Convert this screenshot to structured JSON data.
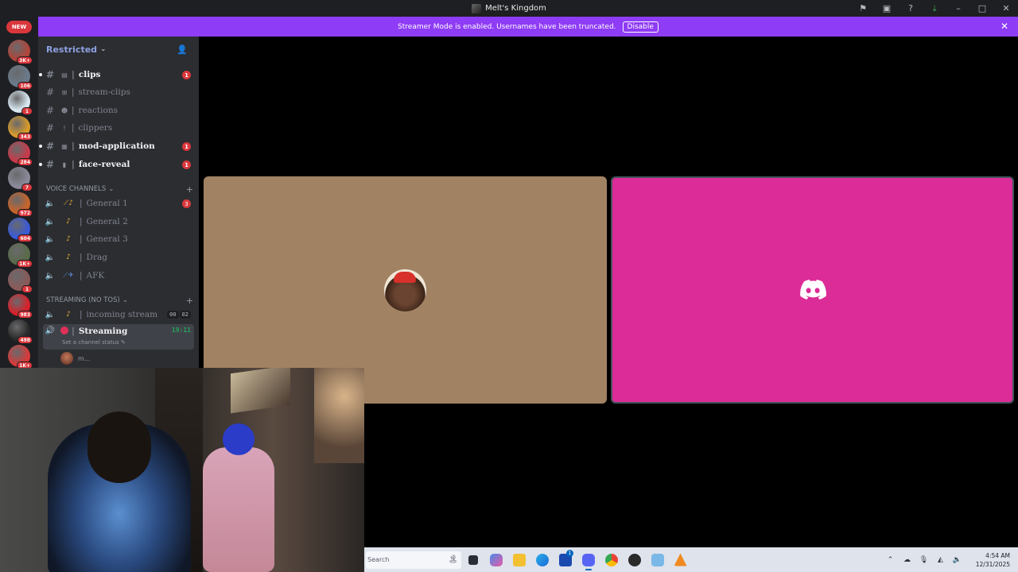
{
  "window": {
    "title": "Melt's Kingdom",
    "controls": [
      "minimize",
      "maximize",
      "close"
    ]
  },
  "banner": {
    "message": "Streamer Mode is enabled. Usernames have been truncated.",
    "button": "Disable"
  },
  "rail": {
    "new_label": "NEW",
    "servers": [
      {
        "badge": "3K+",
        "color": "#b0453a"
      },
      {
        "badge": "106",
        "color": "#6a7a8a"
      },
      {
        "badge": "1",
        "color": "#d8e8f0"
      },
      {
        "badge": "343",
        "color": "#d89a2a"
      },
      {
        "badge": "284",
        "color": "#c83a4a"
      },
      {
        "badge": "7",
        "color": "#8a8a9a"
      },
      {
        "badge": "972",
        "color": "#c8642a"
      },
      {
        "badge": "604",
        "color": "#3a5ad8"
      },
      {
        "badge": "1K+",
        "color": "#5a6a4a"
      },
      {
        "badge": "1",
        "color": "#8a5a5a"
      },
      {
        "badge": "983",
        "color": "#d8202a"
      },
      {
        "badge": "498",
        "color": "#2a2a2a"
      },
      {
        "badge": "1K+",
        "color": "#d83a3a"
      },
      {
        "badge": "",
        "color": "#3a4a8a"
      }
    ]
  },
  "sidebar": {
    "server_name": "Restricted",
    "text_channels": [
      {
        "name": "clips",
        "unread": true,
        "mentions": "1"
      },
      {
        "name": "stream-clips",
        "unread": false,
        "mentions": ""
      },
      {
        "name": "reactions",
        "unread": false,
        "mentions": ""
      },
      {
        "name": "clippers",
        "unread": false,
        "mentions": ""
      },
      {
        "name": "mod-application",
        "unread": true,
        "mentions": "1"
      },
      {
        "name": "face-reveal",
        "unread": true,
        "mentions": "1"
      }
    ],
    "voice_category": "VOICE CHANNELS",
    "voice_channels": [
      {
        "name": "General 1",
        "mentions": "3"
      },
      {
        "name": "General 2",
        "mentions": ""
      },
      {
        "name": "General 3",
        "mentions": ""
      },
      {
        "name": "Drag",
        "mentions": ""
      },
      {
        "name": "AFK",
        "mentions": ""
      }
    ],
    "streaming_category": "STREAMING (NO TOS)",
    "incoming": {
      "name": "incoming stream",
      "count_a": "00",
      "count_b": "02"
    },
    "active": {
      "name": "Streaming",
      "timer": "19:11",
      "status_hint": "Set a channel status"
    },
    "connected_user": "m..."
  },
  "stage": {
    "tile_colors": [
      "#a18262",
      "#dc2c97"
    ]
  },
  "taskbar": {
    "search_placeholder": "Search",
    "apps": [
      "task-view",
      "copilot",
      "file-explorer",
      "edge",
      "store",
      "discord",
      "chrome",
      "obs",
      "other",
      "vlc"
    ],
    "store_badge": "1",
    "time": "4:54 AM",
    "date": "12/31/2025"
  }
}
